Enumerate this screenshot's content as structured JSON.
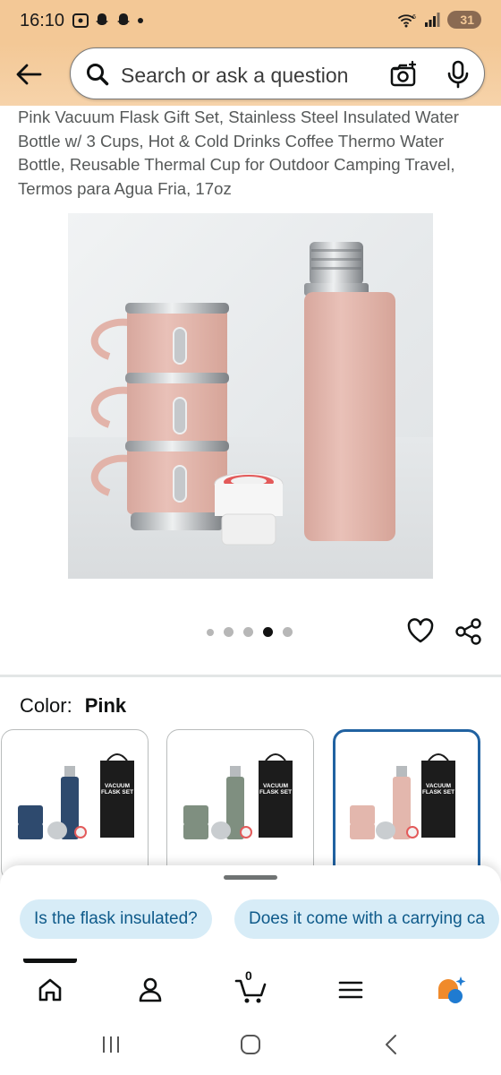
{
  "status_bar": {
    "time": "16:10",
    "battery": "31",
    "network": "6"
  },
  "search": {
    "placeholder": "Search or ask a question"
  },
  "product": {
    "title": "Pink Vacuum Flask Gift Set, Stainless Steel Insulated Water Bottle w/ 3 Cups, Hot & Cold Drinks Coffee Thermo Water Bottle, Reusable Thermal Cup for Outdoor Camping Travel, Termos para Agua Fria, 17oz",
    "image_count": 5,
    "active_image_index": 3
  },
  "color": {
    "label": "Color:",
    "selected": "Pink",
    "swatches": [
      {
        "name": "Navy",
        "color": "#2e4a6e",
        "box_label": "VACUUM\nFLASK SET",
        "selected": false
      },
      {
        "name": "Sage",
        "color": "#7f8f80",
        "box_label": "VACUUM\nFLASK SET",
        "selected": false
      },
      {
        "name": "Pink",
        "color": "#e3b7ad",
        "box_label": "VACUUM\nFLASK SET",
        "selected": true
      }
    ]
  },
  "swatch_box_text": {
    "line1": "VACUUM",
    "line2": "FLASK SET"
  },
  "suggestions": [
    "Is the flask insulated?",
    "Does it come with a carrying ca"
  ],
  "bottom_nav": {
    "cart_count": "0"
  },
  "colors": {
    "accent": "#2162a1",
    "header": "#f3c896",
    "chip_bg": "#d7ecf7",
    "chip_text": "#0e5a8a",
    "flask_pink": "#e3b7ad"
  }
}
